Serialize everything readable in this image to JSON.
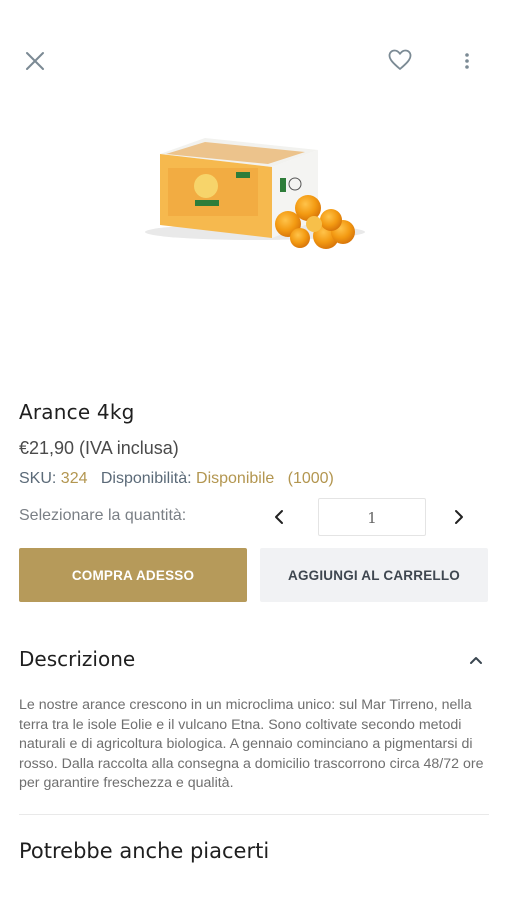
{
  "header": {
    "close_icon": "close-icon",
    "favorite_icon": "heart-outline-icon",
    "more_icon": "more-vertical-icon"
  },
  "product": {
    "image": "box-of-oranges-image",
    "title": "Arance 4kg",
    "price": "€21,90 (IVA inclusa)",
    "sku_label": "SKU:",
    "sku_value": "324",
    "availability_label": "Disponibilità:",
    "availability_value": "Disponibile",
    "availability_count": "(1000)"
  },
  "quantity": {
    "label": "Selezionare la quantità:",
    "value": "1"
  },
  "actions": {
    "buy_now": "COMPRA ADESSO",
    "add_to_cart": "AGGIUNGI AL CARRELLO"
  },
  "description": {
    "heading": "Descrizione",
    "text": "Le nostre arance crescono in un microclima unico: sul Mar Tirreno, nella terra tra le isole Eolie  e il vulcano Etna. Sono coltivate secondo metodi naturali e di agricoltura biologica. A gennaio cominciano a pigmentarsi di rosso. Dalla raccolta alla consegna a domicilio trascorrono circa 48/72 ore per garantire freschezza e qualità."
  },
  "related": {
    "heading": "Potrebbe anche piacerti"
  },
  "colors": {
    "accent": "#b69a5a",
    "secondary_button": "#f1f2f4",
    "gold_text": "#b39650"
  }
}
